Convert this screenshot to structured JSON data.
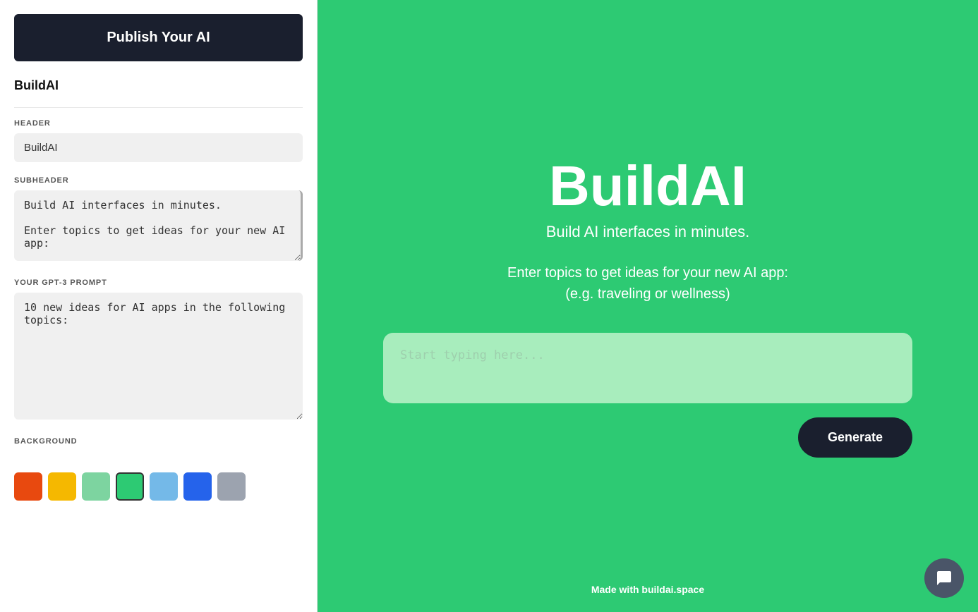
{
  "publish_button": {
    "label": "Publish Your AI"
  },
  "left_panel": {
    "app_name": "BuildAI",
    "header_section": {
      "label": "HEADER",
      "value": "BuildAI",
      "placeholder": "BuildAI"
    },
    "subheader_section": {
      "label": "SUBHEADER",
      "value": "Build AI interfaces in minutes.\n\nEnter topics to get ideas for your new AI app:"
    },
    "prompt_section": {
      "label": "YOUR GPT-3 PROMPT",
      "value": "10 new ideas for AI apps in the following topics:"
    },
    "background_section": {
      "label": "BACKGROUND",
      "colors": [
        {
          "name": "orange",
          "hex": "#e8490f"
        },
        {
          "name": "yellow",
          "hex": "#f5b800"
        },
        {
          "name": "light-green",
          "hex": "#7dd4a0"
        },
        {
          "name": "green",
          "hex": "#2dca73"
        },
        {
          "name": "light-blue",
          "hex": "#74b9e8"
        },
        {
          "name": "blue",
          "hex": "#2563eb"
        },
        {
          "name": "gray",
          "hex": "#9ca3af"
        }
      ]
    }
  },
  "right_panel": {
    "title": "BuildAI",
    "subtitle": "Build AI interfaces in minutes.",
    "description": "Enter topics to get ideas for your new AI app:\n(e.g. traveling or wellness)",
    "input_placeholder": "Start typing here...",
    "generate_button": "Generate",
    "footer": "Made with buildai.space",
    "background_color": "#2dca73"
  }
}
